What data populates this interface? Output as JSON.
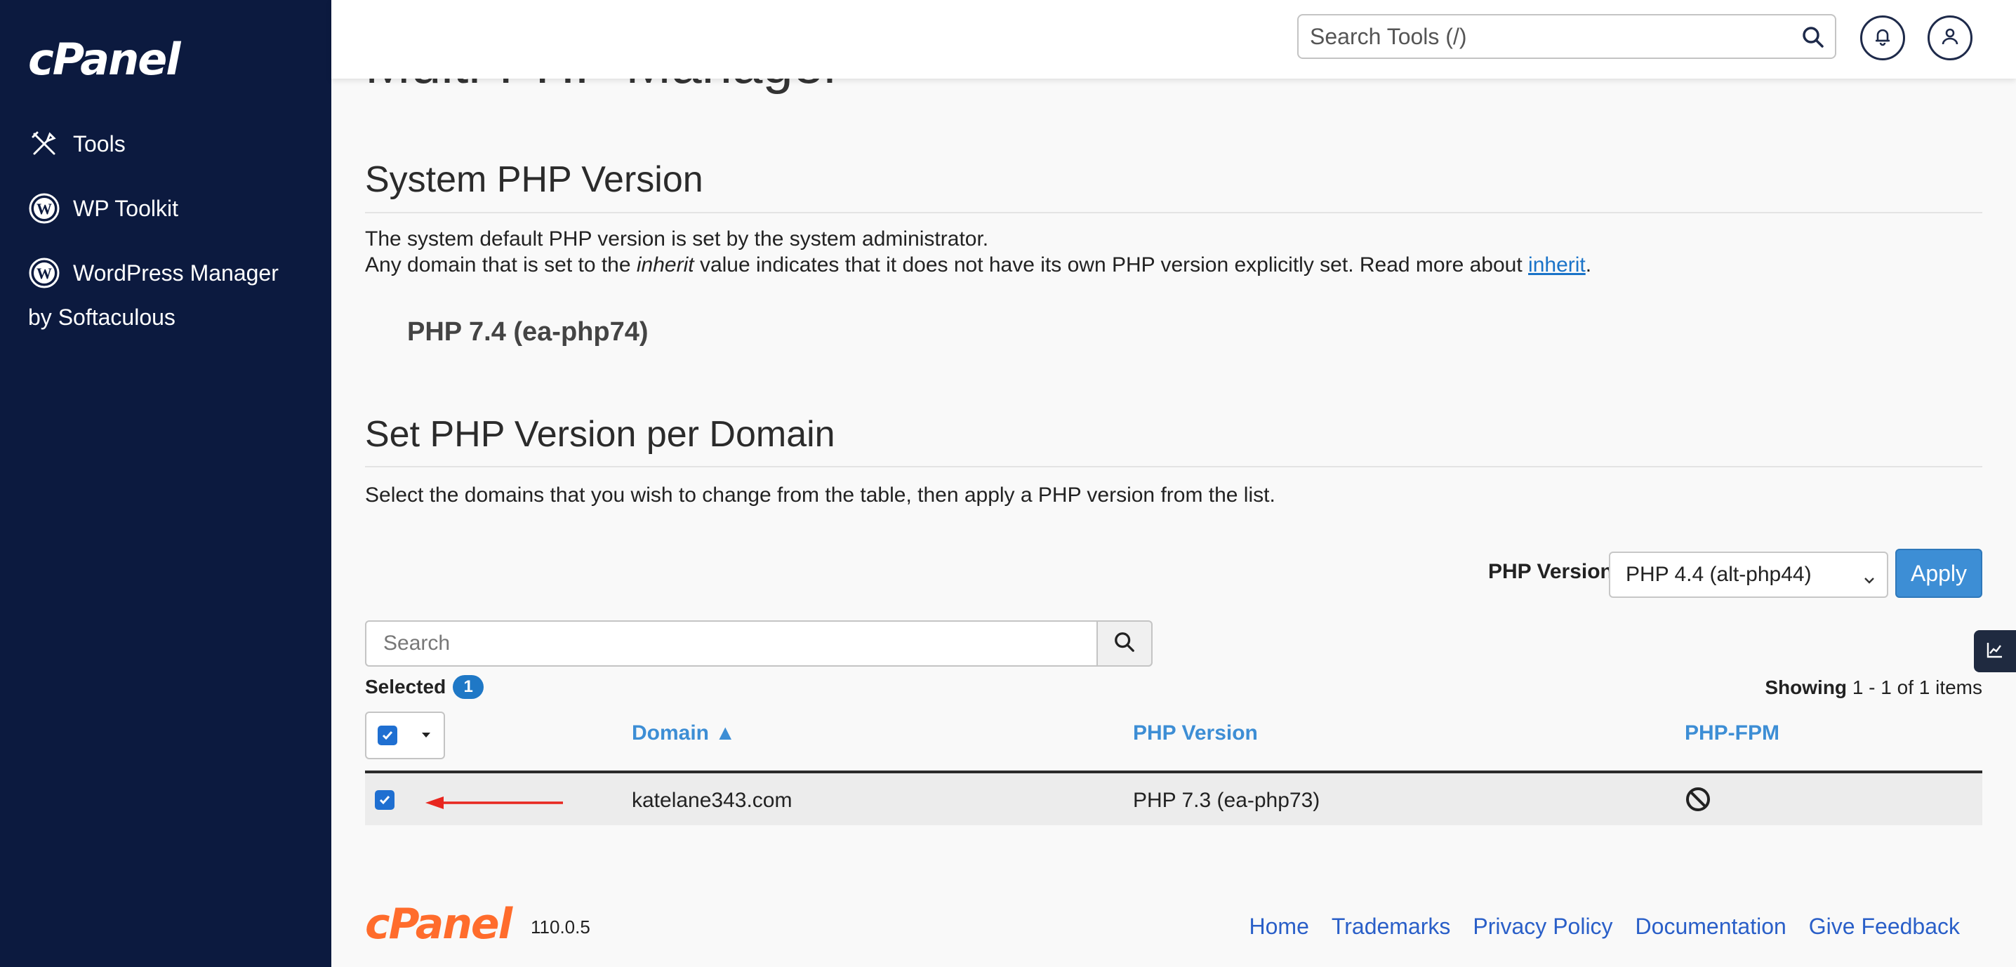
{
  "brand": {
    "logo_text": "cPanel"
  },
  "sidebar": {
    "items": [
      {
        "label": "Tools",
        "icon": "tools-icon"
      },
      {
        "label": "WP Toolkit",
        "icon": "wordpress-icon"
      },
      {
        "label": "WordPress Manager",
        "icon": "wordpress-icon"
      }
    ],
    "sub_label": "by Softaculous"
  },
  "topbar": {
    "search_placeholder": "Search Tools (/)",
    "notifications_icon": "bell-icon",
    "user_icon": "user-icon"
  },
  "page": {
    "title_cut": "Multi-PHP Manager",
    "system_section": {
      "heading": "System PHP Version",
      "line1": "The system default PHP version is set by the system administrator.",
      "line2_prefix": "Any domain that is set to the ",
      "line2_em": "inherit",
      "line2_mid": " value indicates that it does not have its own PHP version explicitly set. Read more about ",
      "line2_link": "inherit",
      "line2_suffix": ".",
      "current_version": "PHP 7.4 (ea-php74)"
    },
    "domain_section": {
      "heading": "Set PHP Version per Domain",
      "description": "Select the domains that you wish to change from the table, then apply a PHP version from the list.",
      "php_version_label": "PHP Version",
      "php_version_selected": "PHP 4.4 (alt-php44)",
      "apply_label": "Apply",
      "search_placeholder": "Search",
      "selected_label": "Selected",
      "selected_count": "1",
      "showing_label": "Showing",
      "showing_range": "1 - 1 of 1 items"
    },
    "table": {
      "columns": [
        "Domain ▲",
        "PHP Version",
        "PHP-FPM"
      ],
      "rows": [
        {
          "domain": "katelane343.com",
          "php_version": "PHP 7.3 (ea-php73)",
          "fpm_icon": "disabled-icon",
          "checked": true
        }
      ]
    }
  },
  "footer": {
    "logo_text": "cPanel",
    "version": "110.0.5",
    "links": [
      "Home",
      "Trademarks",
      "Privacy Policy",
      "Documentation",
      "Give Feedback"
    ]
  },
  "colors": {
    "sidebar_bg": "#0c1a3f",
    "link": "#1a73c8",
    "accent": "#3d8ed5",
    "footer_logo": "#ff6c2c",
    "annotation_arrow": "#e8261f"
  }
}
